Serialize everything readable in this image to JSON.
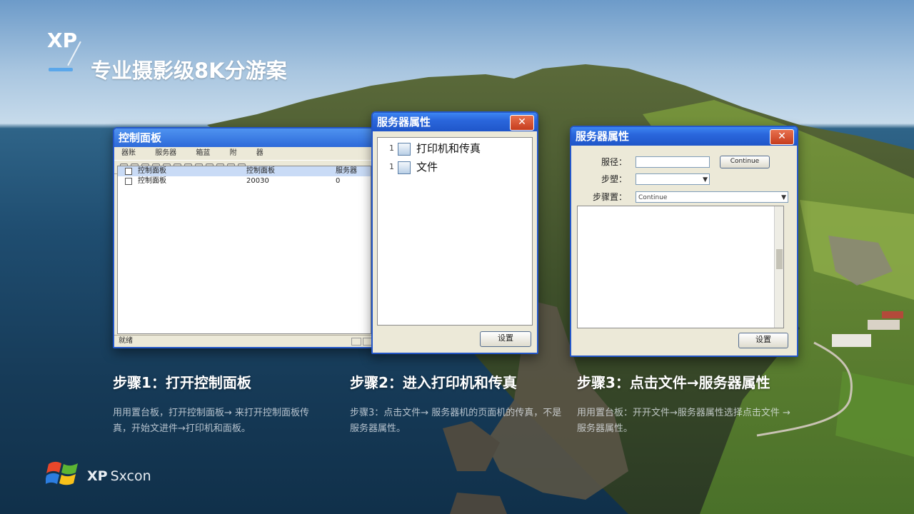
{
  "header": {
    "logo": "XP",
    "headline": "专业摄影级8K分游案"
  },
  "window_control_panel": {
    "title": "控制面板",
    "menu": [
      "器账",
      "服务器",
      "箱蓝",
      "附",
      "器"
    ],
    "rows": [
      {
        "name": "控制面板",
        "col2": "控制面板",
        "col3": "服务器"
      },
      {
        "name": "控制面板",
        "col2": "20030",
        "col3": "0"
      }
    ],
    "status": "就绪"
  },
  "window_server_props_tree": {
    "title": "服务器属性",
    "close": "✕",
    "items": [
      {
        "num": "1",
        "label": "打印机和传真"
      },
      {
        "num": "1",
        "label": "文件"
      }
    ],
    "button": "设置"
  },
  "window_server_props_form": {
    "title": "服务器属性",
    "close": "✕",
    "field1_label": "服径：",
    "field1_button": "Continue",
    "field2_label": "步塑：",
    "field2_value": "",
    "field3_label": "步骤置：",
    "field3_value": "Continue",
    "button": "设置"
  },
  "steps": [
    {
      "title": "步骤1：打开控制面板",
      "desc": "用用置台板，打开控制面板→ 来打开控制面板传真，开始文进件→打印机和面板。"
    },
    {
      "title": "步骤2：进入打印机和传真",
      "desc": "步骤3：点击文件→ 服务器机的页面机的传真，不是服务器属性。"
    },
    {
      "title": "步骤3：点击文件→服务器属性",
      "desc": "用用置台板：开开文件→服务器属性选择点击文件 → 服务器属性。"
    }
  ],
  "footer": {
    "brand_bold": "XP",
    "brand_rest": "Sxcon"
  },
  "colors": {
    "xp_blue": "#2457c9",
    "close_red": "#c63c1d",
    "accent_bar": "#5ba7ea"
  }
}
